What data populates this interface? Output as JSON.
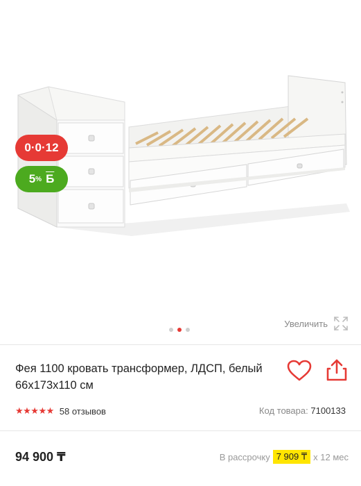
{
  "badges": {
    "installment": "0·0·12",
    "bonus_percent": "5",
    "bonus_percent_sign": "%",
    "bonus_letter": "Б"
  },
  "gallery": {
    "zoom_label": "Увеличить",
    "active_slide": 2,
    "slide_count": 3
  },
  "product": {
    "title": "Фея 1100 кровать трансформер, ЛДСП, белый 66х173х110 см",
    "rating_stars": "★★★★★",
    "reviews": "58 отзывов",
    "sku_label": "Код товара:",
    "sku_value": "7100133",
    "price": "94 900 ₸",
    "installment_label": "В рассрочку",
    "installment_amount": "7 909 ₸",
    "installment_term": "х 12 мес"
  },
  "colors": {
    "accent": "#e63a35",
    "bonus": "#4caa1f",
    "highlight": "#ffe500"
  }
}
